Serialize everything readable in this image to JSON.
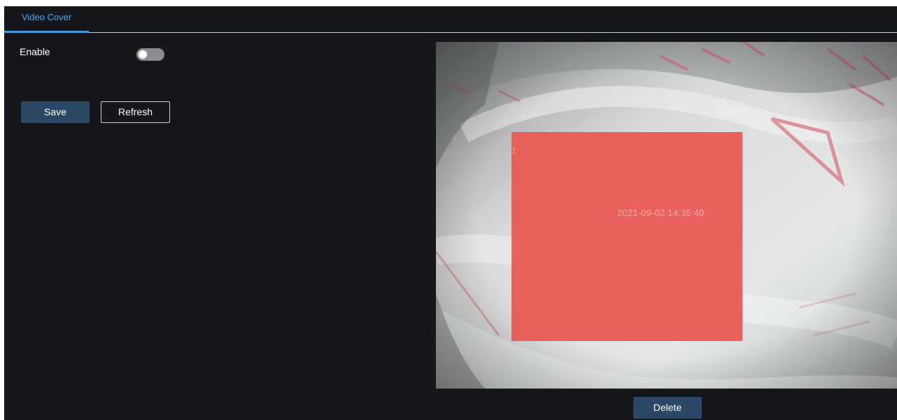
{
  "tabs": [
    {
      "label": "Video Cover",
      "active": true
    }
  ],
  "form": {
    "enable_label": "Enable",
    "enable_value": false,
    "save_label": "Save",
    "refresh_label": "Refresh"
  },
  "preview": {
    "osd_timestamp": "2021-09-02 14:35:40",
    "cover_regions": [
      {
        "index_label": "1"
      }
    ],
    "delete_label": "Delete"
  },
  "colors": {
    "accent": "#3f9be0",
    "primary_button": "#2a4866",
    "background": "#16171b",
    "cover_region": "#ea5652"
  }
}
